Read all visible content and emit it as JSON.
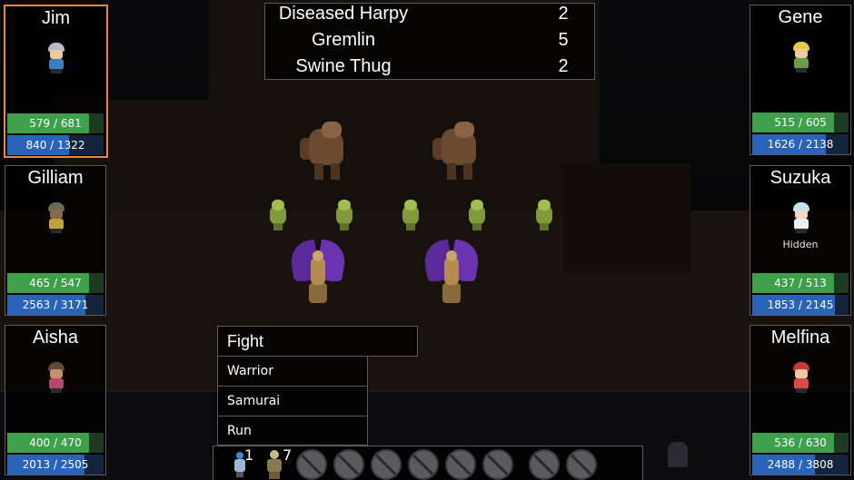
{
  "enemies": [
    {
      "name": "Diseased Harpy",
      "count": "2"
    },
    {
      "name": "Gremlin",
      "count": "5"
    },
    {
      "name": "Swine Thug",
      "count": "2"
    }
  ],
  "party": {
    "jim": {
      "name": "Jim",
      "hp": "579 / 681",
      "hp_frac": 0.85,
      "mp": "840 / 1322",
      "mp_frac": 0.64,
      "status": "",
      "hair": "#b9bcc4",
      "skin": "#f0c8a0",
      "outfit": "#3b7ec2",
      "active": true
    },
    "gilliam": {
      "name": "Gilliam",
      "hp": "465 / 547",
      "hp_frac": 0.85,
      "mp": "2563 / 3171",
      "mp_frac": 0.81,
      "status": "",
      "hair": "#6b6b55",
      "skin": "#8a6a4a",
      "outfit": "#c4a23a"
    },
    "aisha": {
      "name": "Aisha",
      "hp": "400 / 470",
      "hp_frac": 0.85,
      "mp": "2013 / 2505",
      "mp_frac": 0.8,
      "status": "",
      "hair": "#5e4a3a",
      "skin": "#c8906a",
      "outfit": "#b44a6a"
    },
    "gene": {
      "name": "Gene",
      "hp": "515 / 605",
      "hp_frac": 0.85,
      "mp": "1626 / 2138",
      "mp_frac": 0.76,
      "status": "",
      "hair": "#e8c84a",
      "skin": "#f0c8a0",
      "outfit": "#6a9a4a"
    },
    "suzuka": {
      "name": "Suzuka",
      "hp": "437 / 513",
      "hp_frac": 0.85,
      "mp": "1853 / 2145",
      "mp_frac": 0.86,
      "status": "Hidden",
      "hair": "#bfe6f0",
      "skin": "#f3d6c0",
      "outfit": "#e8eef2"
    },
    "melfina": {
      "name": "Melfina",
      "hp": "536 / 630",
      "hp_frac": 0.85,
      "mp": "2488 / 3808",
      "mp_frac": 0.65,
      "status": "",
      "hair": "#c83a3a",
      "skin": "#f0c8a0",
      "outfit": "#d84a4a"
    }
  },
  "command": {
    "title": "Fight",
    "options": [
      "Warrior",
      "Samurai",
      "Run"
    ]
  },
  "hotbar": {
    "item1_count": "1",
    "item2_count": "7",
    "empty_slots": 8
  },
  "colors": {
    "active_border": "#e8863a",
    "hp_fill": "#3ea04a",
    "mp_fill": "#2a63b8"
  }
}
